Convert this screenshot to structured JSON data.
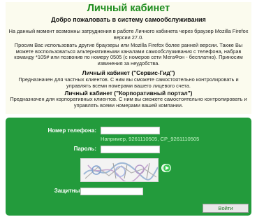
{
  "header": {
    "title": "Личный кабинет",
    "welcome": "Добро пожаловать в систему самообслуживания"
  },
  "notice": {
    "line1": "На данный момент возможны затруднения в работе Личного кабинета через браузер Mozilla Firefox версии 27.0.",
    "line2": "Просим Вас использовать другие браузеры или Mozilla Firefox более ранней версии. Также Вы можете воспользоваться альтернативными каналами самообслуживания с телефона, набрав команду *105# или позвонив по номеру 0505 (с номеров сети МегаФон - бесплатно). Приносим извинения за неудобства."
  },
  "sections": [
    {
      "title": "Личный кабинет (\"Сервис-Гид\")",
      "text": "Предназначен для частных клиентов. С ним вы сможете самостоятельно контролировать и управлять всеми номерами вашего лицевого счета."
    },
    {
      "title": "Личный кабинет (\"Корпоративный портал\")",
      "text": "Предназначен для корпоративных клиентов. С ним вы сможете самостоятельно контролировать и управлять всеми номерами вашей компании."
    }
  ],
  "form": {
    "phone_label": "Номер телефона:",
    "phone_value": "",
    "phone_hint": "Например, 9261110505, CP_9261110505",
    "password_label": "Пароль:",
    "password_value": "",
    "code_label": "Защитный код:",
    "code_value": "",
    "submit_label": "Войти",
    "icons": {
      "refresh": "refresh-icon",
      "audio": "audio-captcha-icon"
    }
  },
  "colors": {
    "accent": "#1e8c1e",
    "panel": "#239b3c",
    "notice_bg": "#fbfbee"
  }
}
